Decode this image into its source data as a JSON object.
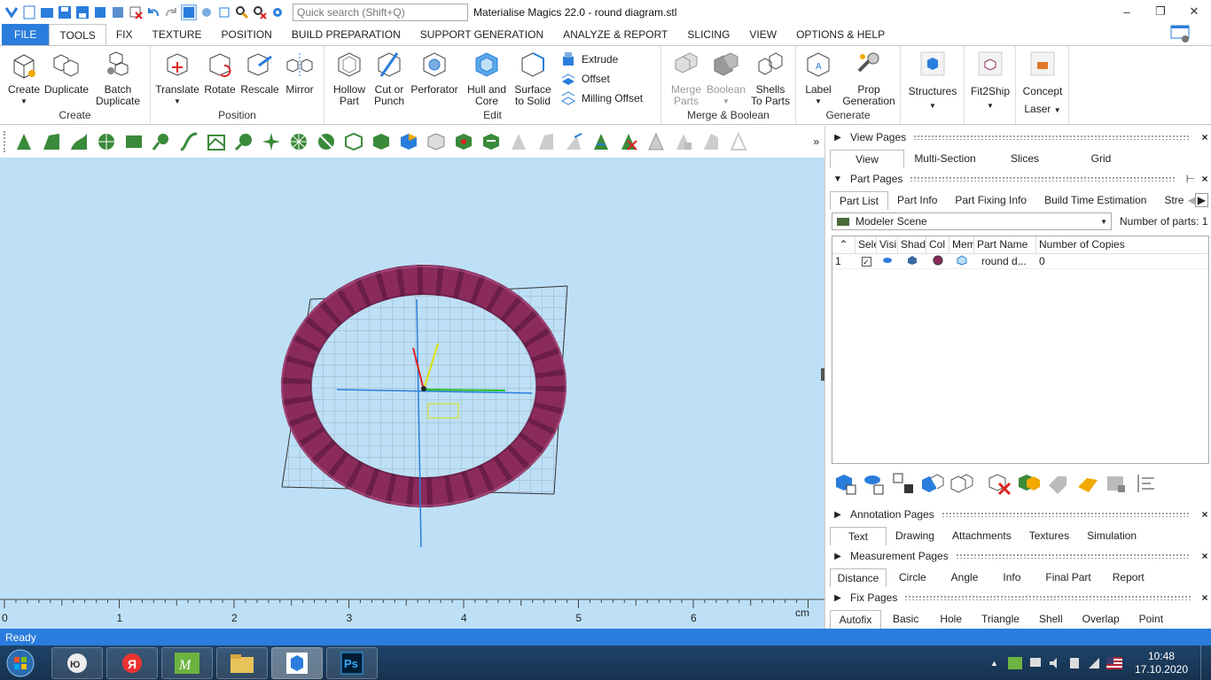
{
  "app": {
    "title": "Materialise Magics 22.0 - round diagram.stl"
  },
  "search": {
    "placeholder": "Quick search (Shift+Q)"
  },
  "menu": {
    "file": "FILE",
    "tabs": [
      "TOOLS",
      "FIX",
      "TEXTURE",
      "POSITION",
      "BUILD PREPARATION",
      "SUPPORT GENERATION",
      "ANALYZE & REPORT",
      "SLICING",
      "VIEW",
      "OPTIONS & HELP"
    ],
    "active": "TOOLS"
  },
  "ribbon": {
    "groups": {
      "create": "Create",
      "position": "Position",
      "edit": "Edit",
      "merge": "Merge & Boolean",
      "generate": "Generate"
    },
    "buttons": {
      "create": "Create",
      "duplicate": "Duplicate",
      "batch_duplicate_1": "Batch",
      "batch_duplicate_2": "Duplicate",
      "translate": "Translate",
      "rotate": "Rotate",
      "rescale": "Rescale",
      "mirror": "Mirror",
      "hollow_1": "Hollow",
      "hollow_2": "Part",
      "cut_1": "Cut or",
      "cut_2": "Punch",
      "perforator": "Perforator",
      "hull_1": "Hull and",
      "hull_2": "Core",
      "surface_1": "Surface",
      "surface_2": "to Solid",
      "extrude": "Extrude",
      "offset": "Offset",
      "milling_offset": "Milling Offset",
      "merge_1": "Merge",
      "merge_2": "Parts",
      "boolean": "Boolean",
      "shells_1": "Shells",
      "shells_2": "To Parts",
      "label": "Label",
      "prop_1": "Prop",
      "prop_2": "Generation",
      "structures": "Structures",
      "fit2ship": "Fit2Ship",
      "concept_1": "Concept",
      "concept_2": "Laser"
    }
  },
  "viewport": {
    "ruler_labels": [
      "0",
      "1",
      "2",
      "3",
      "4",
      "5",
      "6"
    ],
    "ruler_unit": "cm"
  },
  "panel": {
    "view_pages": {
      "title": "View Pages",
      "tabs": [
        "View",
        "Multi-Section",
        "Slices",
        "Grid"
      ]
    },
    "part_pages": {
      "title": "Part Pages",
      "tabs": [
        "Part List",
        "Part Info",
        "Part Fixing Info",
        "Build Time Estimation",
        "Stre"
      ],
      "scene": "Modeler Scene",
      "num_parts_label": "Number of parts:",
      "num_parts": "1",
      "columns": [
        "Sele",
        "Visi",
        "Shad",
        "Col",
        "Mem",
        "Part Name",
        "Number of Copies"
      ],
      "rows": [
        {
          "idx": "1",
          "name": "round d...",
          "copies": "0"
        }
      ]
    },
    "annotation_pages": {
      "title": "Annotation Pages",
      "tabs": [
        "Text",
        "Drawing",
        "Attachments",
        "Textures",
        "Simulation"
      ]
    },
    "measurement_pages": {
      "title": "Measurement Pages",
      "tabs": [
        "Distance",
        "Circle",
        "Angle",
        "Info",
        "Final Part",
        "Report"
      ]
    },
    "fix_pages": {
      "title": "Fix Pages",
      "tabs": [
        "Autofix",
        "Basic",
        "Hole",
        "Triangle",
        "Shell",
        "Overlap",
        "Point"
      ]
    }
  },
  "status": {
    "text": "Ready"
  },
  "taskbar": {
    "time": "10:48",
    "date": "17.10.2020"
  },
  "colors": {
    "accent": "#2a7ddc",
    "viewport_bg": "#bde0f7",
    "part": "#8b2b5c"
  }
}
